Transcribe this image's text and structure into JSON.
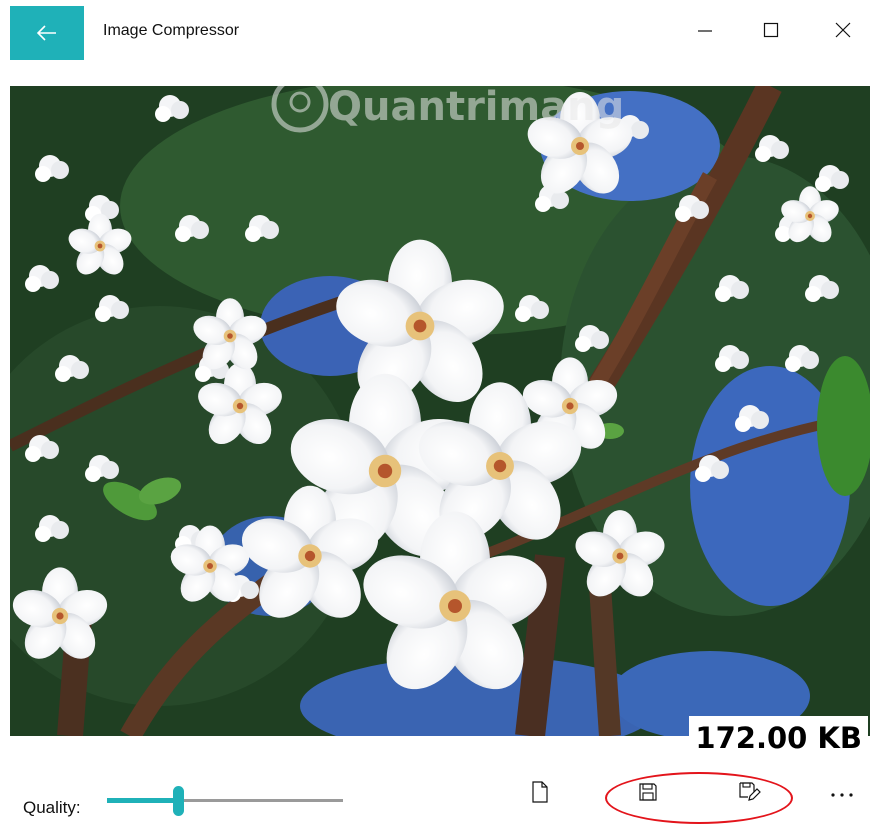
{
  "titlebar": {
    "title": "Image Compressor",
    "back_icon": "arrow-left-icon",
    "minimize_icon": "minimize-icon",
    "maximize_icon": "maximize-icon",
    "close_icon": "close-icon",
    "accent_color": "#1fb1b8"
  },
  "preview": {
    "watermark": "Quantrimang",
    "file_size": "172.00 KB"
  },
  "toolbar": {
    "quality_label": "Quality:",
    "quality_value": 0.3,
    "open_icon": "page-icon",
    "save_icon": "save-icon",
    "save_as_icon": "save-as-icon",
    "more_icon": "more-icon",
    "highlight_color": "#e3141b"
  }
}
